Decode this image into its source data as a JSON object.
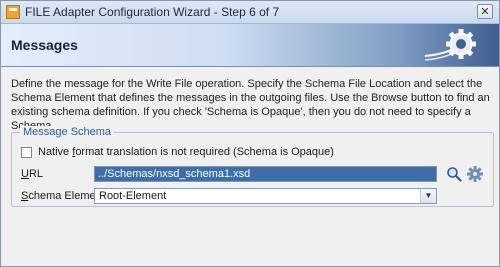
{
  "window": {
    "title": "FILE Adapter Configuration Wizard - Step 6 of 7",
    "close_glyph": "✕"
  },
  "header": {
    "title": "Messages"
  },
  "description": "Define the message for the Write File operation.  Specify the Schema File Location and select the Schema Element that defines the messages in the outgoing files. Use the Browse button to find an existing schema definition. If you check 'Schema is Opaque', then you do not need to specify a Schema.",
  "message_schema": {
    "legend": "Message Schema",
    "opaque_checkbox": {
      "label_prefix": "Native ",
      "label_mnemonic": "f",
      "label_rest": "ormat translation is not required (Schema is Opaque)",
      "checked": false
    },
    "url": {
      "label_mnemonic": "U",
      "label_rest": "RL",
      "value": "../Schemas/nxsd_schema1.xsd"
    },
    "schema_element": {
      "label_mnemonic": "S",
      "label_rest": "chema Element",
      "value": "Root-Element",
      "arrow": "▼"
    }
  },
  "icons": {
    "search": "search-icon",
    "settings": "settings-icon",
    "header": "gear-icon"
  }
}
